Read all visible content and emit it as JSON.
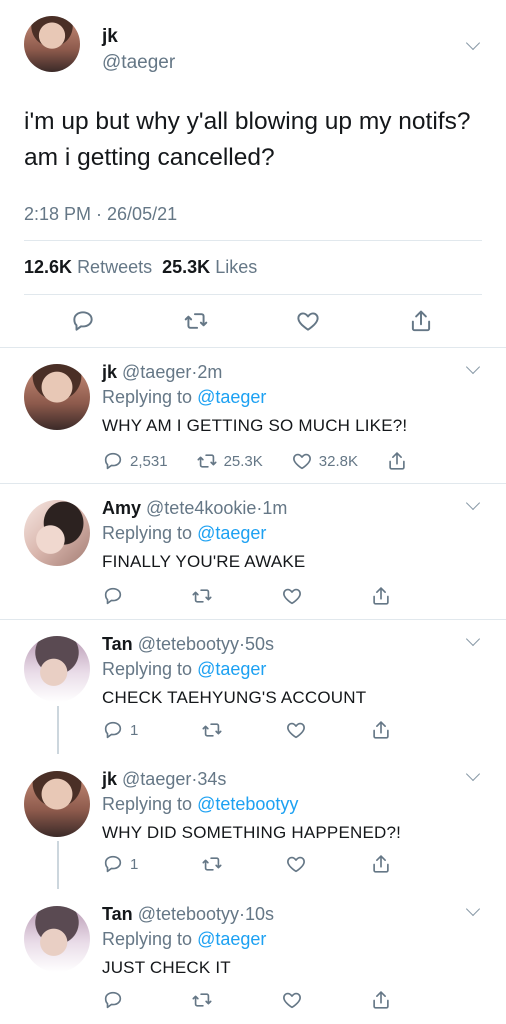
{
  "main_tweet": {
    "name": "jk",
    "handle": "@taeger",
    "text": "i'm up but why y'all blowing up my notifs? am i getting cancelled?",
    "timestamp": "2:18 PM · 26/05/21",
    "retweets_count": "12.6K",
    "retweets_label": "Retweets",
    "likes_count": "25.3K",
    "likes_label": "Likes"
  },
  "replies": [
    {
      "name": "jk",
      "handle": "@taeger",
      "time": "2m",
      "replying_label": "Replying to",
      "replying_to": "@taeger",
      "text": "WHY AM I GETTING SO MUCH LIKE?!",
      "reply_count": "2,531",
      "retweet_count": "25.3K",
      "like_count": "32.8K",
      "avatar": "jk"
    },
    {
      "name": "Amy",
      "handle": "@tete4kookie",
      "time": "1m",
      "replying_label": "Replying to",
      "replying_to": "@taeger",
      "text": "FINALLY YOU'RE AWAKE",
      "reply_count": "",
      "retweet_count": "",
      "like_count": "",
      "avatar": "amy"
    },
    {
      "name": "Tan",
      "handle": "@tetebootyy",
      "time": "50s",
      "replying_label": "Replying to",
      "replying_to": "@taeger",
      "text": "CHECK TAEHYUNG'S ACCOUNT",
      "reply_count": "1",
      "retweet_count": "",
      "like_count": "",
      "avatar": "tan"
    },
    {
      "name": "jk",
      "handle": "@taeger",
      "time": "34s",
      "replying_label": "Replying to",
      "replying_to": "@tetebootyy",
      "text": "WHY DID SOMETHING HAPPENED?!",
      "reply_count": "1",
      "retweet_count": "",
      "like_count": "",
      "avatar": "jk"
    },
    {
      "name": "Tan",
      "handle": "@tetebootyy",
      "time": "10s",
      "replying_label": "Replying to",
      "replying_to": "@taeger",
      "text": "JUST CHECK IT",
      "reply_count": "",
      "retweet_count": "",
      "like_count": "",
      "avatar": "tan"
    }
  ],
  "icons": {
    "more": "chevron-down-icon",
    "reply": "reply-icon",
    "retweet": "retweet-icon",
    "like": "heart-icon",
    "share": "share-icon"
  },
  "colors": {
    "text": "#14171a",
    "secondary": "#657786",
    "link": "#1da1f2",
    "divider": "#e1e8ed"
  }
}
